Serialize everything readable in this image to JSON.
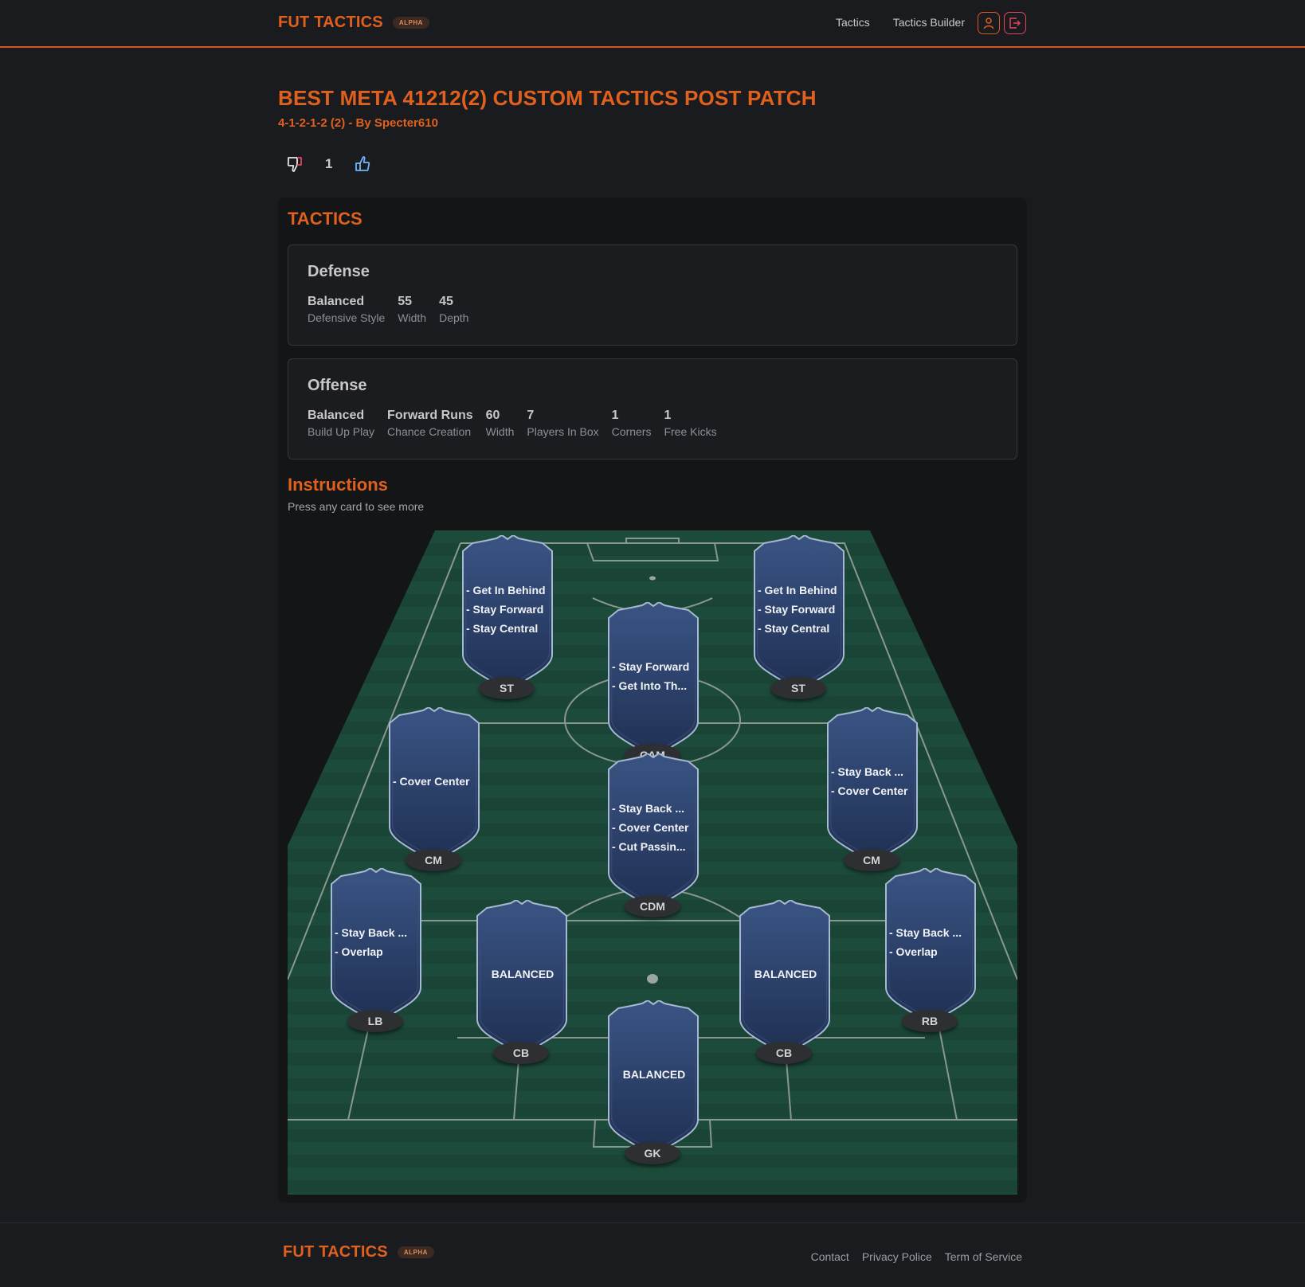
{
  "header": {
    "brand": "FUT TACTICS",
    "badge": "ALPHA",
    "nav": [
      "Tactics",
      "Tactics Builder"
    ],
    "icons": [
      "user-icon",
      "logout-icon"
    ]
  },
  "page": {
    "title": "BEST META 41212(2) CUSTOM TACTICS POST PATCH",
    "subtitle": "4-1-2-1-2 (2) - By Specter610",
    "votes": "1"
  },
  "tactics": {
    "title": "TACTICS",
    "defense": {
      "title": "Defense",
      "stats": [
        {
          "value": "Balanced",
          "label": "Defensive Style"
        },
        {
          "value": "55",
          "label": "Width"
        },
        {
          "value": "45",
          "label": "Depth"
        }
      ]
    },
    "offense": {
      "title": "Offense",
      "stats": [
        {
          "value": "Balanced",
          "label": "Build Up Play"
        },
        {
          "value": "Forward Runs",
          "label": "Chance Creation"
        },
        {
          "value": "60",
          "label": "Width"
        },
        {
          "value": "7",
          "label": "Players In Box"
        },
        {
          "value": "1",
          "label": "Corners"
        },
        {
          "value": "1",
          "label": "Free Kicks"
        }
      ]
    }
  },
  "instructions": {
    "title": "Instructions",
    "hint": "Press any card to see more",
    "players": [
      {
        "pos": "ST",
        "lines": [
          "- Get In Behind",
          "- Stay Forward",
          "- Stay Central"
        ]
      },
      {
        "pos": "ST",
        "lines": [
          "- Get In Behind",
          "- Stay Forward",
          "- Stay Central"
        ]
      },
      {
        "pos": "CAM",
        "lines": [
          "- Stay Forward",
          "- Get Into Th..."
        ]
      },
      {
        "pos": "CM",
        "lines": [
          "- Cover Center"
        ]
      },
      {
        "pos": "CDM",
        "lines": [
          "- Stay Back ...",
          "- Cover Center",
          "- Cut Passin..."
        ]
      },
      {
        "pos": "CM",
        "lines": [
          "- Stay Back ...",
          "- Cover Center"
        ]
      },
      {
        "pos": "LB",
        "lines": [
          "- Stay Back ...",
          "- Overlap"
        ]
      },
      {
        "pos": "CB",
        "lines": [
          "BALANCED"
        ]
      },
      {
        "pos": "CB",
        "lines": [
          "BALANCED"
        ]
      },
      {
        "pos": "RB",
        "lines": [
          "- Stay Back ...",
          "- Overlap"
        ]
      },
      {
        "pos": "GK",
        "lines": [
          "BALANCED"
        ]
      }
    ]
  },
  "footer": {
    "brand": "FUT TACTICS",
    "badge": "ALPHA",
    "links": [
      "Contact",
      "Privacy Police",
      "Term of Service"
    ]
  },
  "colors": {
    "accent": "#e0601e",
    "pitch": "#1c4a3a",
    "card": "#2c4068"
  }
}
